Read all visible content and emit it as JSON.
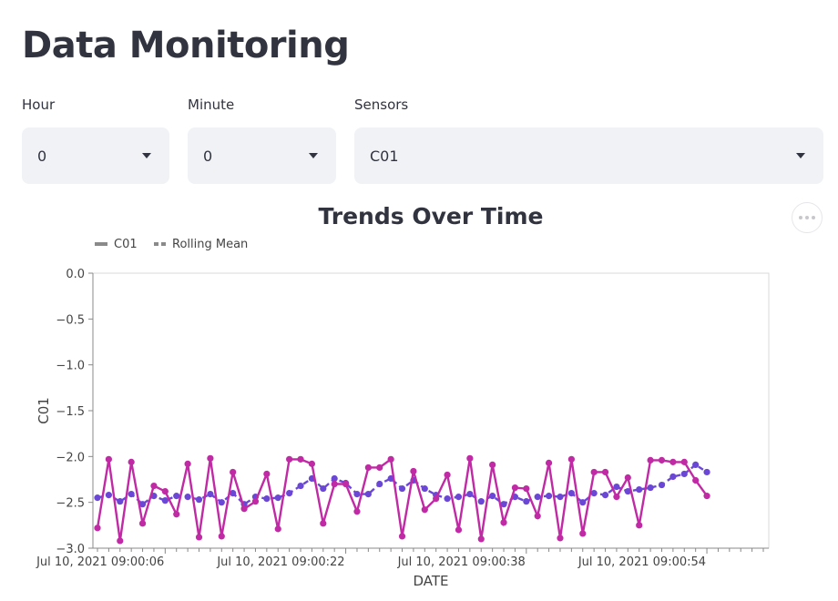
{
  "page": {
    "title": "Data Monitoring"
  },
  "filters": {
    "hour": {
      "label": "Hour",
      "value": "0"
    },
    "minute": {
      "label": "Minute",
      "value": "0"
    },
    "sensors": {
      "label": "Sensors",
      "value": "C01"
    }
  },
  "chart_menu_icon": "more-horizontal-icon",
  "chart_data": {
    "type": "line",
    "title": "Trends Over Time",
    "xlabel": "DATE",
    "ylabel": "C01",
    "ylim": [
      -3.0,
      0.0
    ],
    "yticks": [
      "0.0",
      "−0.5",
      "−1.0",
      "−1.5",
      "−2.0",
      "−2.5",
      "−3.0"
    ],
    "xticks": [
      "Jul 10, 2021  09:00:06",
      "Jul 10, 2021  09:00:22",
      "Jul 10, 2021  09:00:38",
      "Jul 10, 2021  09:00:54"
    ],
    "x_seconds": [
      0,
      1,
      2,
      3,
      4,
      5,
      6,
      7,
      8,
      9,
      10,
      11,
      12,
      13,
      14,
      15,
      16,
      17,
      18,
      19,
      20,
      21,
      22,
      23,
      24,
      25,
      26,
      27,
      28,
      29,
      30,
      31,
      32,
      33,
      34,
      35,
      36,
      37,
      38,
      39,
      40,
      41,
      42,
      43,
      44,
      45,
      46,
      47,
      48,
      49,
      50,
      51,
      52,
      53,
      54,
      55,
      56,
      57,
      58,
      59
    ],
    "legend_position": "top-left",
    "series": [
      {
        "name": "C01",
        "color": "#c02aa4",
        "style": "solid",
        "values": [
          -2.78,
          -2.03,
          -2.92,
          -2.06,
          -2.73,
          -2.32,
          -2.38,
          -2.63,
          -2.08,
          -2.88,
          -2.02,
          -2.87,
          -2.17,
          -2.57,
          -2.49,
          -2.19,
          -2.79,
          -2.03,
          -2.03,
          -2.08,
          -2.73,
          -2.3,
          -2.3,
          -2.6,
          -2.12,
          -2.12,
          -2.03,
          -2.87,
          -2.16,
          -2.58,
          -2.46,
          -2.2,
          -2.8,
          -2.02,
          -2.9,
          -2.09,
          -2.72,
          -2.34,
          -2.35,
          -2.65,
          -2.07,
          -2.89,
          -2.03,
          -2.84,
          -2.17,
          -2.17,
          -2.44,
          -2.23,
          -2.75,
          -2.04,
          -2.04,
          -2.06,
          -2.06,
          -2.26,
          -2.43
        ]
      },
      {
        "name": "Rolling Mean",
        "color": "#6b47d6",
        "style": "dashed",
        "values": [
          -2.45,
          -2.42,
          -2.49,
          -2.41,
          -2.52,
          -2.43,
          -2.48,
          -2.43,
          -2.44,
          -2.47,
          -2.41,
          -2.5,
          -2.4,
          -2.52,
          -2.44,
          -2.46,
          -2.45,
          -2.4,
          -2.32,
          -2.24,
          -2.35,
          -2.24,
          -2.29,
          -2.41,
          -2.41,
          -2.3,
          -2.24,
          -2.35,
          -2.26,
          -2.35,
          -2.42,
          -2.46,
          -2.44,
          -2.41,
          -2.49,
          -2.43,
          -2.52,
          -2.44,
          -2.49,
          -2.44,
          -2.43,
          -2.44,
          -2.4,
          -2.5,
          -2.4,
          -2.42,
          -2.33,
          -2.38,
          -2.36,
          -2.34,
          -2.31,
          -2.22,
          -2.19,
          -2.09,
          -2.17
        ]
      }
    ]
  }
}
